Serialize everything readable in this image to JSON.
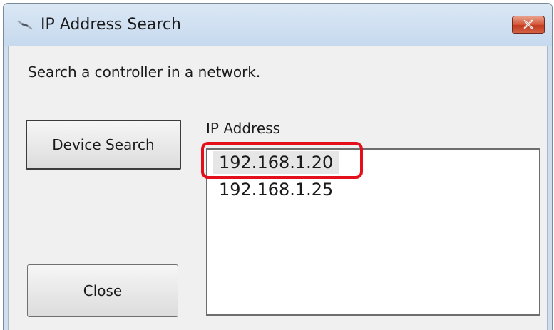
{
  "window": {
    "title": "IP Address Search"
  },
  "dialog": {
    "instruction": "Search a controller in a network.",
    "device_search_label": "Device Search",
    "close_label": "Close",
    "list_label": "IP Address",
    "ip_addresses": [
      "192.168.1.20",
      "192.168.1.25"
    ],
    "selected_index": 0
  },
  "icons": {
    "app": "network-device-icon",
    "close": "close-icon"
  },
  "colors": {
    "title_close_button": "#d5573a",
    "highlight_annotation": "#e3101c",
    "selected_row": "#e6e6e6"
  }
}
